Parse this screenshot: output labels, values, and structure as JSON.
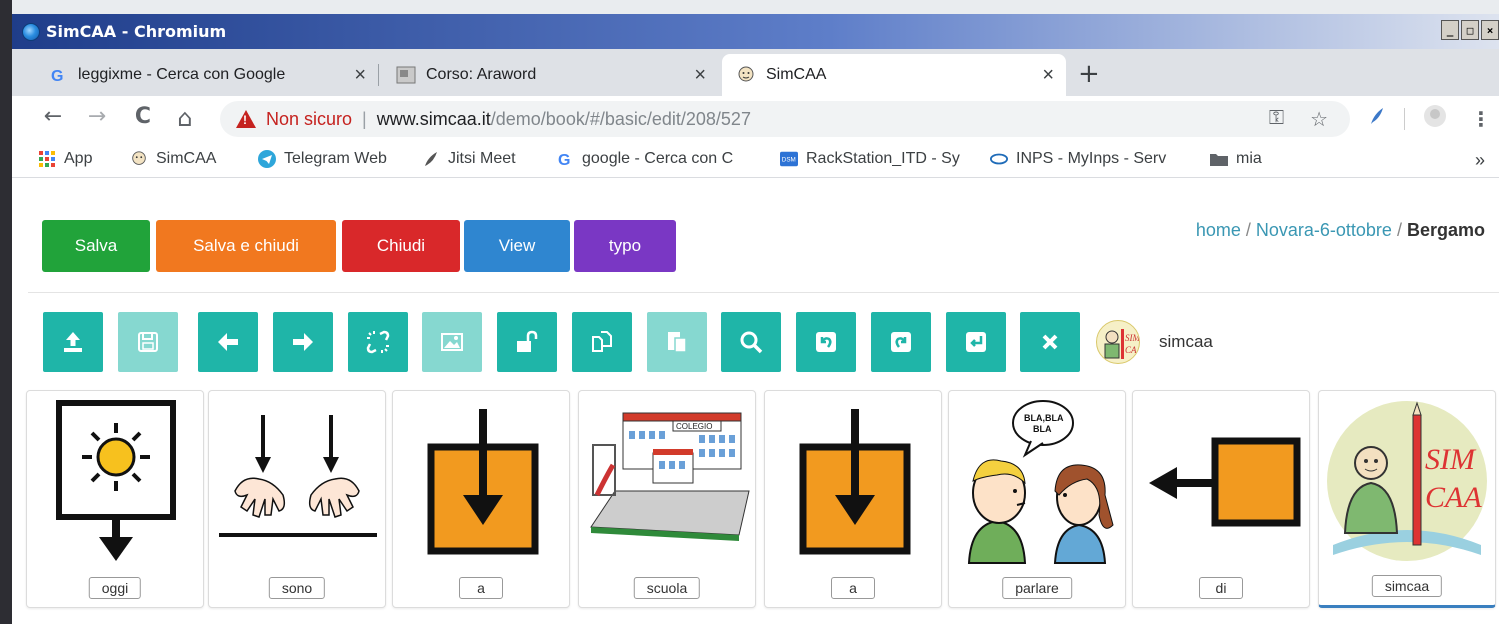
{
  "window": {
    "title": "SimCAA - Chromium",
    "controls": [
      "_",
      "□",
      "×"
    ]
  },
  "tabs": [
    {
      "label": "leggixme - Cerca con Google",
      "icon": "google-icon"
    },
    {
      "label": "Corso: Araword",
      "icon": "moodle-icon"
    },
    {
      "label": "SimCAA",
      "icon": "simcaa-icon",
      "active": true
    }
  ],
  "tab_close": "×",
  "new_tab": "+",
  "nav": {
    "back": "←",
    "forward": "→",
    "reload": "C",
    "home": "⌂",
    "security_label": "Non sicuro",
    "separator": "|",
    "url_host": "www.simcaa.it",
    "url_path": "/demo/book/#/basic/edit/208/527",
    "key": "⚿",
    "star": "☆",
    "menu": "⋮"
  },
  "bookmarks": [
    {
      "label": "App",
      "icon": "apps-grid-icon"
    },
    {
      "label": "SimCAA",
      "icon": "simcaa-icon"
    },
    {
      "label": "Telegram Web",
      "icon": "telegram-icon"
    },
    {
      "label": "Jitsi Meet",
      "icon": "jitsi-icon"
    },
    {
      "label": "google - Cerca con C",
      "icon": "google-icon"
    },
    {
      "label": "RackStation_ITD - Sy",
      "icon": "dsm-icon"
    },
    {
      "label": "INPS - MyInps - Serv",
      "icon": "inps-icon"
    },
    {
      "label": "mia",
      "icon": "folder-icon"
    }
  ],
  "bookmarks_more": "»",
  "actions": [
    {
      "label": "Salva",
      "color": "#21a33a"
    },
    {
      "label": "Salva e chiudi",
      "color": "#f1781f"
    },
    {
      "label": "Chiudi",
      "color": "#d9282a"
    },
    {
      "label": "View",
      "color": "#2f86d0"
    },
    {
      "label": "typo",
      "color": "#7a37c4"
    }
  ],
  "breadcrumb": {
    "home": "home",
    "sep": "/",
    "project": "Novara-6-ottobre",
    "current": "Bergamo"
  },
  "tools": [
    {
      "name": "upload",
      "enabled": true
    },
    {
      "name": "save",
      "enabled": false
    },
    {
      "name": "arrow-left",
      "enabled": true
    },
    {
      "name": "arrow-right",
      "enabled": true
    },
    {
      "name": "unlink",
      "enabled": true
    },
    {
      "name": "image",
      "enabled": false
    },
    {
      "name": "unlock",
      "enabled": true
    },
    {
      "name": "copy",
      "enabled": true
    },
    {
      "name": "paste",
      "enabled": false
    },
    {
      "name": "search",
      "enabled": true
    },
    {
      "name": "undo",
      "enabled": true
    },
    {
      "name": "redo",
      "enabled": true
    },
    {
      "name": "return",
      "enabled": true
    },
    {
      "name": "close",
      "enabled": true
    }
  ],
  "profile": {
    "name": "simcaa"
  },
  "cards": [
    {
      "label": "oggi",
      "symbol": "today"
    },
    {
      "label": "sono",
      "symbol": "hands-down"
    },
    {
      "label": "a",
      "symbol": "arrow-in-box"
    },
    {
      "label": "scuola",
      "symbol": "school"
    },
    {
      "label": "a",
      "symbol": "arrow-in-box"
    },
    {
      "label": "parlare",
      "symbol": "talk"
    },
    {
      "label": "di",
      "symbol": "arrow-from-box"
    },
    {
      "label": "simcaa",
      "symbol": "simcaa-logo"
    }
  ],
  "symbol_texts": {
    "bubble_line1": "BLA,BLA",
    "bubble_line2": "BLA",
    "school_sign": "COLEGIO",
    "logo_top": "SIM",
    "logo_bottom": "CAA"
  }
}
